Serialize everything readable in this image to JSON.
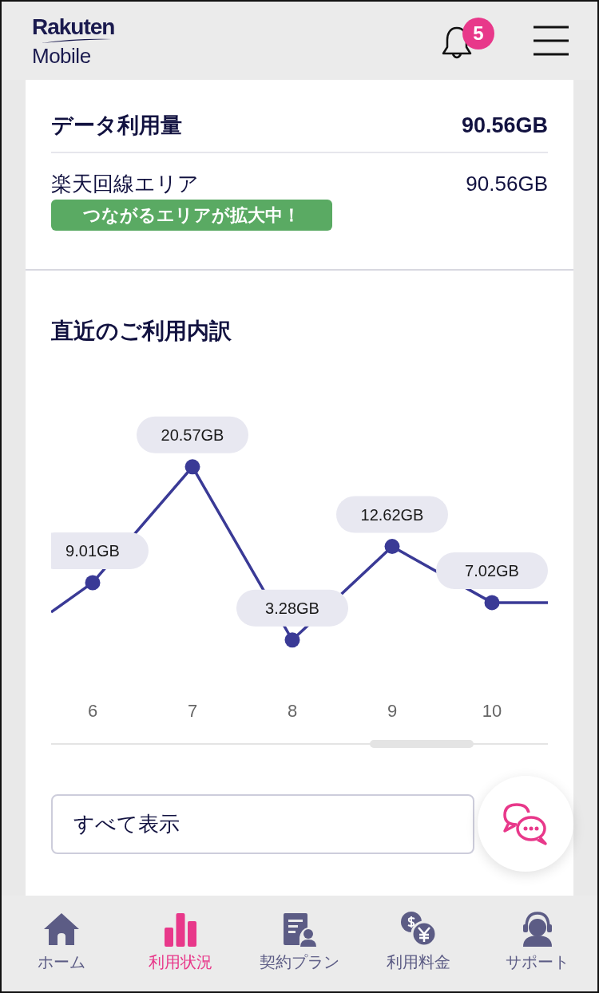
{
  "header": {
    "logo": [
      "Rakuten",
      "Mobile"
    ],
    "notification_count": "5"
  },
  "usage": {
    "total": {
      "label": "データ利用量",
      "value": "90.56GB"
    },
    "rows": [
      {
        "label": "楽天回線エリア",
        "value": "90.56GB",
        "tag": "つながるエリアが拡大中！"
      }
    ]
  },
  "recent": {
    "title": "直近のご利用内訳",
    "chart_data": {
      "type": "line",
      "marker": "circle",
      "categories": [
        "6",
        "7",
        "8",
        "9",
        "10"
      ],
      "values": [
        9.01,
        20.57,
        3.28,
        12.62,
        7.02
      ],
      "value_labels": [
        "9.01GB",
        "20.57GB",
        "3.28GB",
        "12.62GB",
        "7.02GB"
      ]
    },
    "show_all_button": "すべて表示"
  },
  "nav": [
    {
      "kind": "home",
      "label": "ホーム",
      "selected": false
    },
    {
      "kind": "usage",
      "label": "利用状況",
      "selected": true
    },
    {
      "kind": "plan",
      "label": "契約プラン",
      "selected": false
    },
    {
      "kind": "fee",
      "label": "利用料金",
      "selected": false
    },
    {
      "kind": "support",
      "label": "サポート",
      "selected": false
    }
  ]
}
